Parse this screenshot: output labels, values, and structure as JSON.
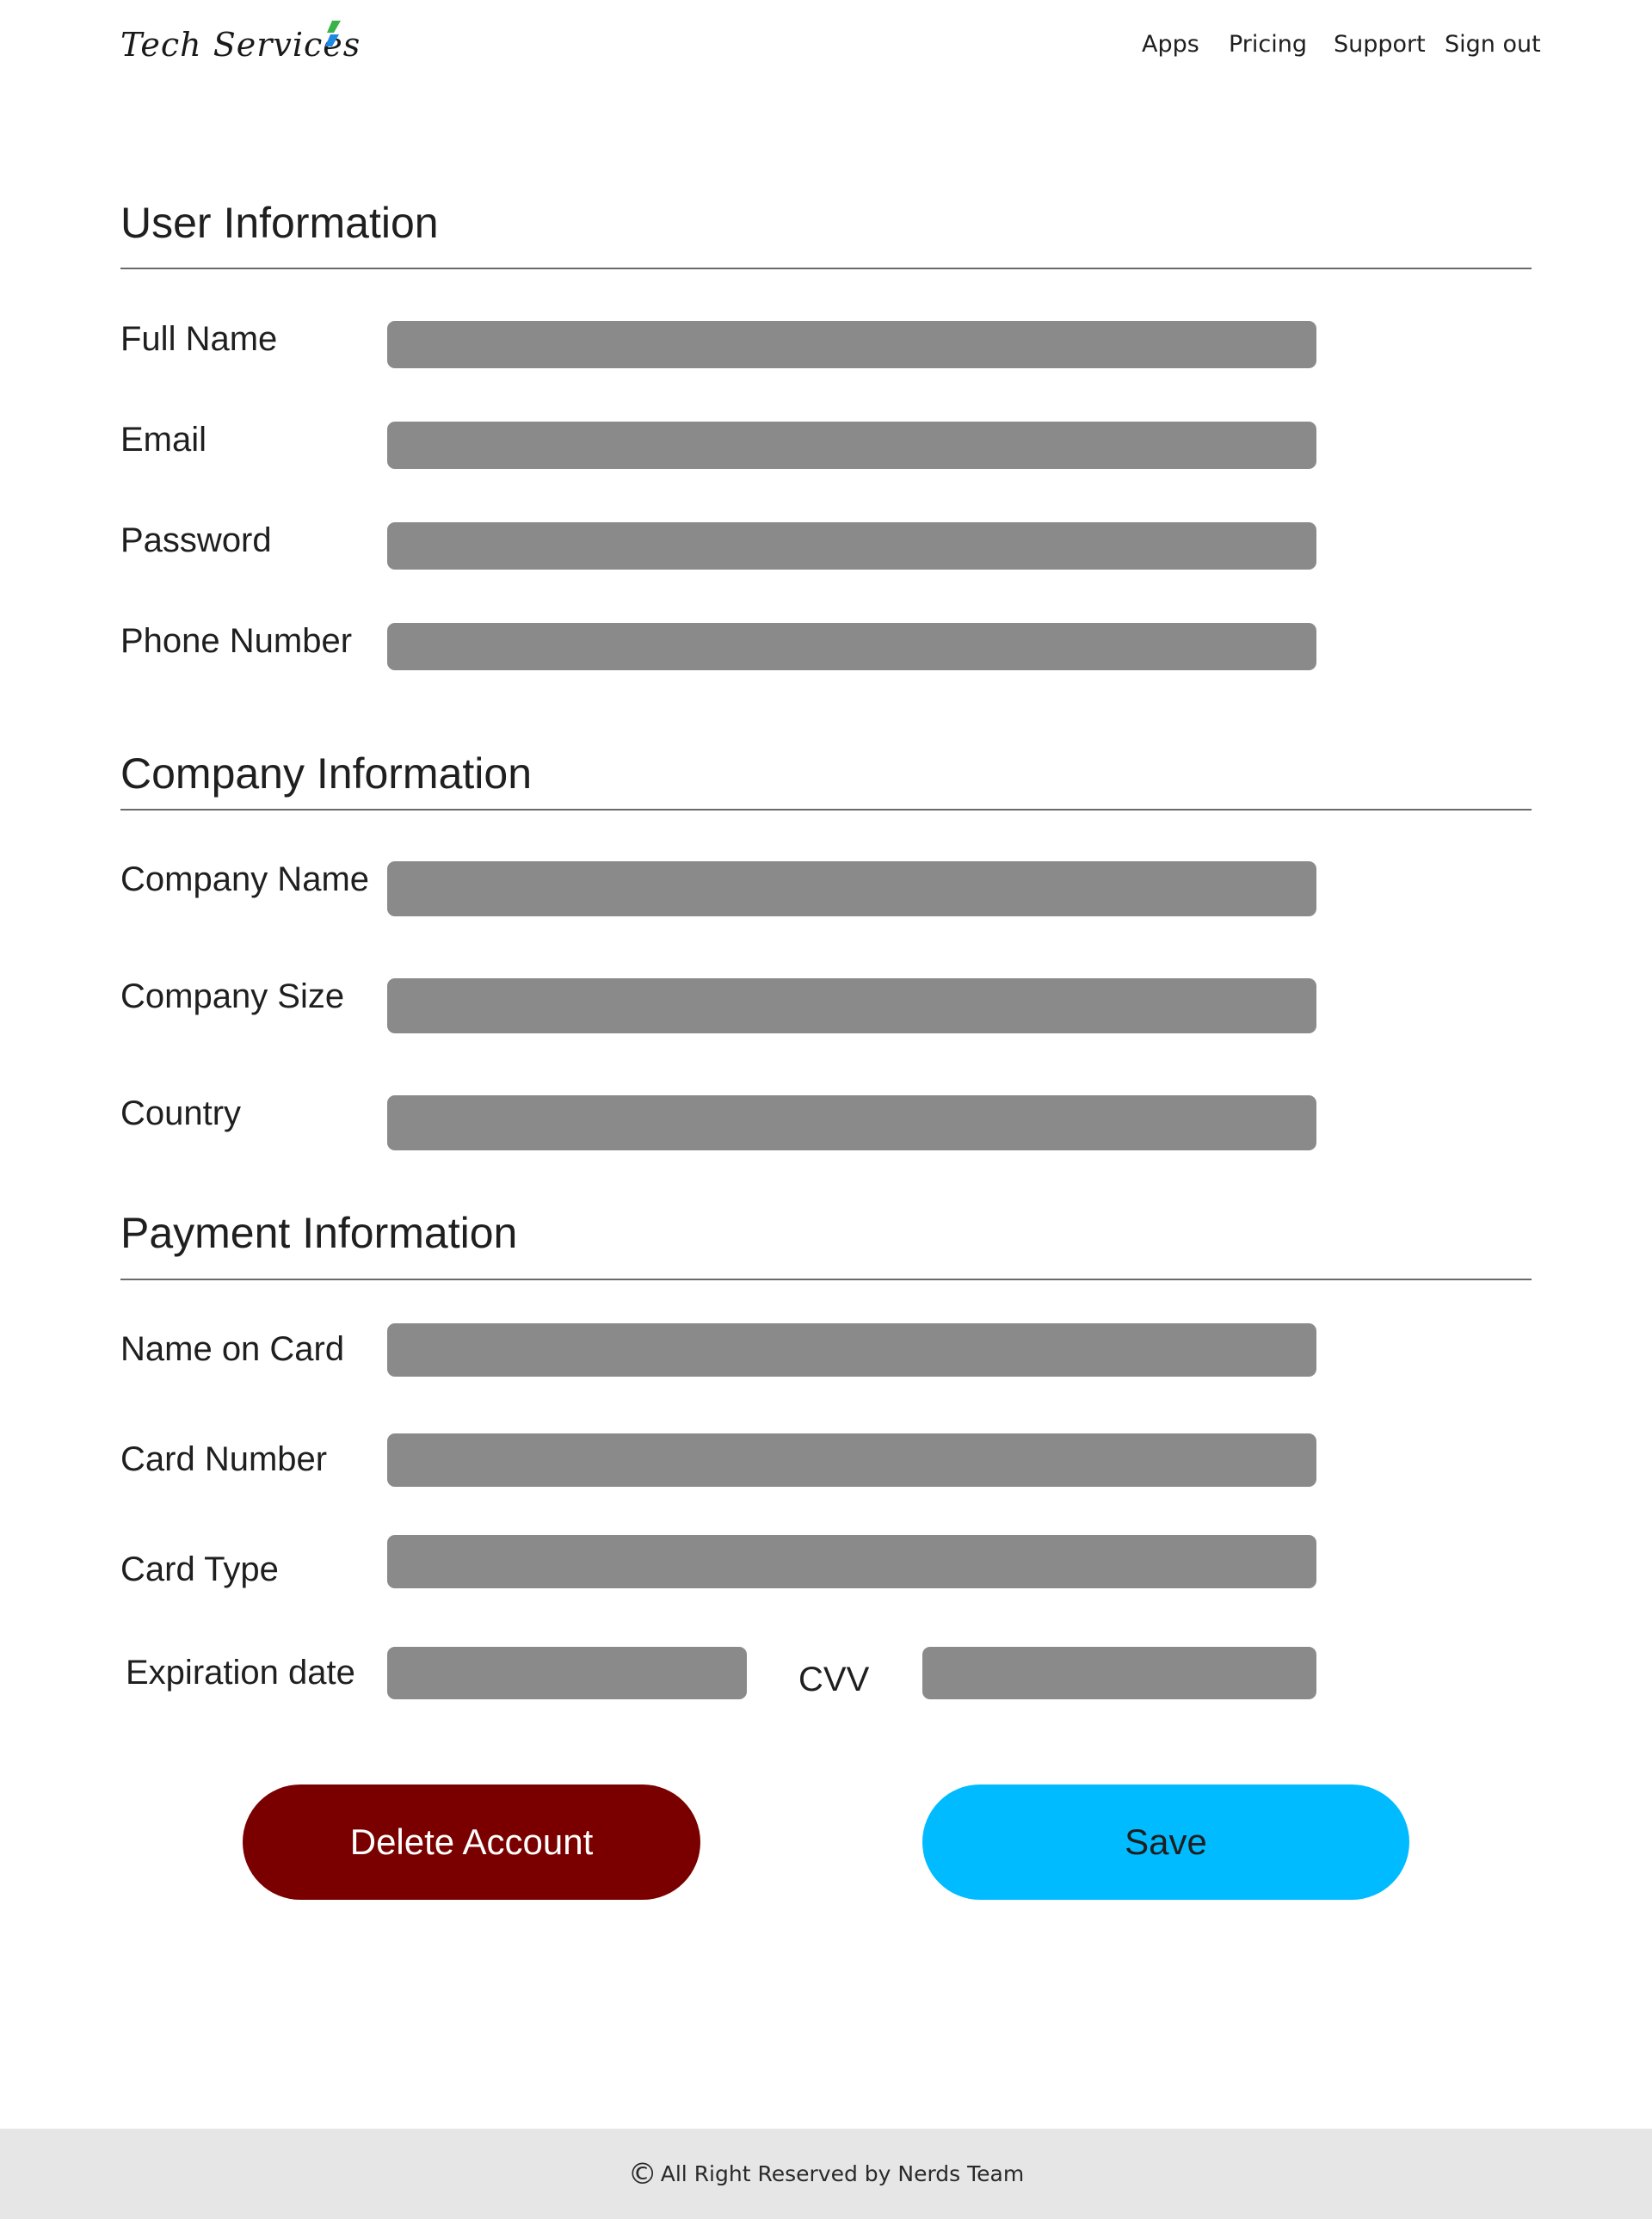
{
  "header": {
    "logo_text": "Tech Services",
    "nav": [
      "Apps",
      "Pricing",
      "Support",
      "Sign out"
    ]
  },
  "sections": {
    "user": {
      "title": "User Information",
      "fields": [
        "Full Name",
        "Email",
        "Password",
        "Phone Number"
      ]
    },
    "company": {
      "title": "Company Information",
      "fields": [
        "Company Name",
        "Company Size",
        "Country"
      ]
    },
    "payment": {
      "title": "Payment Information",
      "fields": [
        "Name on Card",
        "Card Number",
        "Card Type",
        "Expiration date",
        "CVV"
      ]
    }
  },
  "buttons": {
    "delete": "Delete Account",
    "save": "Save"
  },
  "footer": {
    "icon": "copyright-icon",
    "text": "All Right Reserved by Nerds Team"
  },
  "colors": {
    "field_bg": "#8a8a8a",
    "delete_bg": "#7a0000",
    "save_bg": "#00bbff",
    "footer_bg": "#e6e6e6"
  }
}
